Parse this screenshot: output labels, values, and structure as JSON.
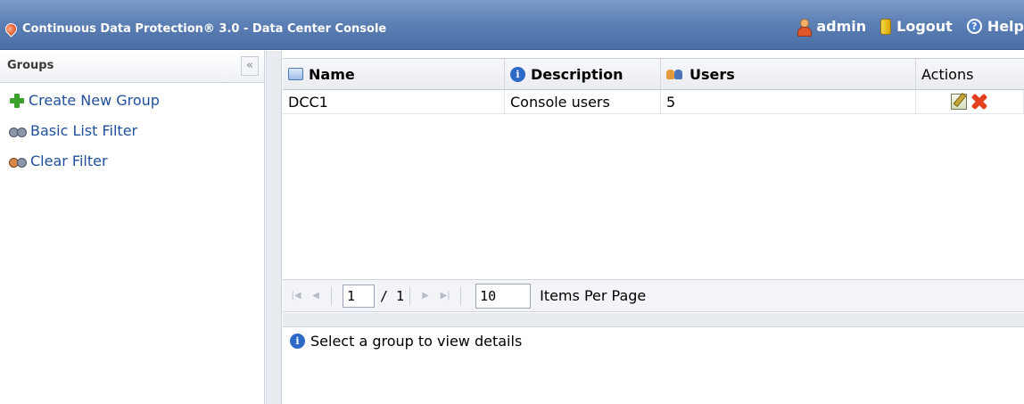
{
  "header": {
    "title": "Continuous Data Protection® 3.0 - Data Center Console",
    "user_label": "admin",
    "logout_label": "Logout",
    "help_label": "Help"
  },
  "sidebar": {
    "title": "Groups",
    "collapse_glyph": "«",
    "items": [
      {
        "label": "Create New Group",
        "icon": "add-icon"
      },
      {
        "label": "Basic List Filter",
        "icon": "binoculars-icon"
      },
      {
        "label": "Clear Filter",
        "icon": "clear-filter-icon"
      }
    ]
  },
  "grid": {
    "columns": [
      "Name",
      "Description",
      "Users",
      "Actions"
    ],
    "rows": [
      {
        "name": "DCC1",
        "description": "Console users",
        "users": "5"
      }
    ]
  },
  "pager": {
    "current_page": "1",
    "total_pages": "/ 1",
    "page_size": "10",
    "page_size_label": "Items Per Page"
  },
  "details": {
    "message": "Select a group to view details"
  },
  "colors": {
    "header_bg": "#5d80b5",
    "link": "#1f4f9c"
  }
}
